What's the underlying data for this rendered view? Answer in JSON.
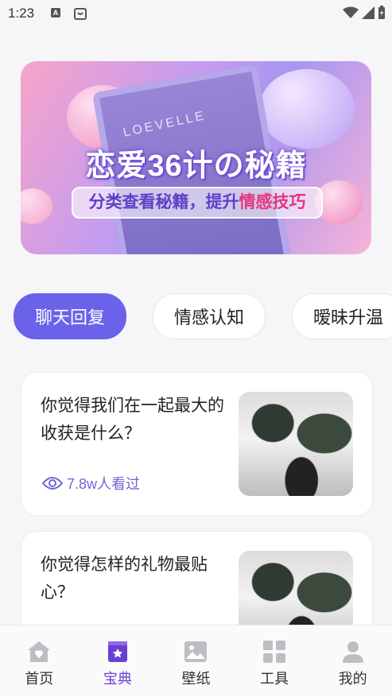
{
  "status_bar": {
    "time": "1:23"
  },
  "banner": {
    "book_label": "LOEVELLE",
    "title": "恋爱36计の秘籍",
    "subtitle_part1": "分类查看秘籍，提升",
    "subtitle_highlight": "情感技巧"
  },
  "categories": [
    {
      "label": "聊天回复",
      "active": true
    },
    {
      "label": "情感认知",
      "active": false
    },
    {
      "label": "暧昧升温",
      "active": false
    }
  ],
  "cards": [
    {
      "title": "你觉得我们在一起最大的收获是什么？",
      "views": "7.8w人看过"
    },
    {
      "title": "你觉得怎样的礼物最贴心？",
      "views": ""
    }
  ],
  "nav": [
    {
      "label": "首页",
      "icon": "home-icon",
      "active": false
    },
    {
      "label": "宝典",
      "icon": "book-icon",
      "active": true
    },
    {
      "label": "壁纸",
      "icon": "image-icon",
      "active": false
    },
    {
      "label": "工具",
      "icon": "grid-icon",
      "active": false
    },
    {
      "label": "我的",
      "icon": "person-icon",
      "active": false
    }
  ],
  "colors": {
    "accent": "#6b62ea",
    "nav_active": "#6a3fd1",
    "highlight": "#e9337d"
  }
}
